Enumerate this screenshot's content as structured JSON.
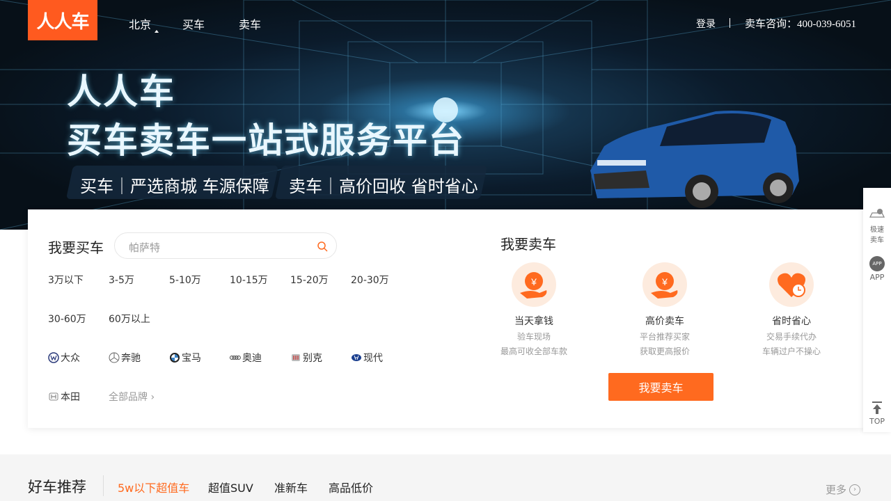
{
  "header": {
    "logo": "人人车",
    "city": "北京",
    "nav_buy": "买车",
    "nav_sell": "卖车",
    "login": "登录",
    "hotline": "卖车咨询：400-039-6051"
  },
  "hero": {
    "title_line1": "人人车",
    "title_line2": "买车卖车一站式服务平台",
    "tag_buy": "买车｜严选商城 车源保障",
    "tag_sell": "卖车｜高价回收 省时省心"
  },
  "buy": {
    "title": "我要买车",
    "search_placeholder": "帕萨特",
    "price_ranges": [
      "3万以下",
      "3-5万",
      "5-10万",
      "10-15万",
      "15-20万",
      "20-30万",
      "30-60万",
      "60万以上"
    ],
    "brands": [
      "大众",
      "奔驰",
      "宝马",
      "奥迪",
      "别克",
      "现代",
      "本田"
    ],
    "all_brands": "全部品牌"
  },
  "sell": {
    "title": "我要卖车",
    "features": [
      {
        "title": "当天拿钱",
        "sub1": "验车现场",
        "sub2": "最高可收全部车款"
      },
      {
        "title": "高价卖车",
        "sub1": "平台推荐买家",
        "sub2": "获取更高报价"
      },
      {
        "title": "省时省心",
        "sub1": "交易手续代办",
        "sub2": "车辆过户不操心"
      }
    ],
    "button": "我要卖车"
  },
  "sidebar": {
    "quick_sell_line1": "极速",
    "quick_sell_line2": "卖车",
    "app_badge": "APP",
    "app_label": "APP",
    "top_label": "TOP"
  },
  "good_cars": {
    "title": "好车推荐",
    "tabs": [
      "5w以下超值车",
      "超值SUV",
      "准新车",
      "高品低价"
    ],
    "active_tab": 0,
    "more": "更多"
  },
  "colors": {
    "brand": "#ff5a1f",
    "accent": "#ff6a1f"
  }
}
